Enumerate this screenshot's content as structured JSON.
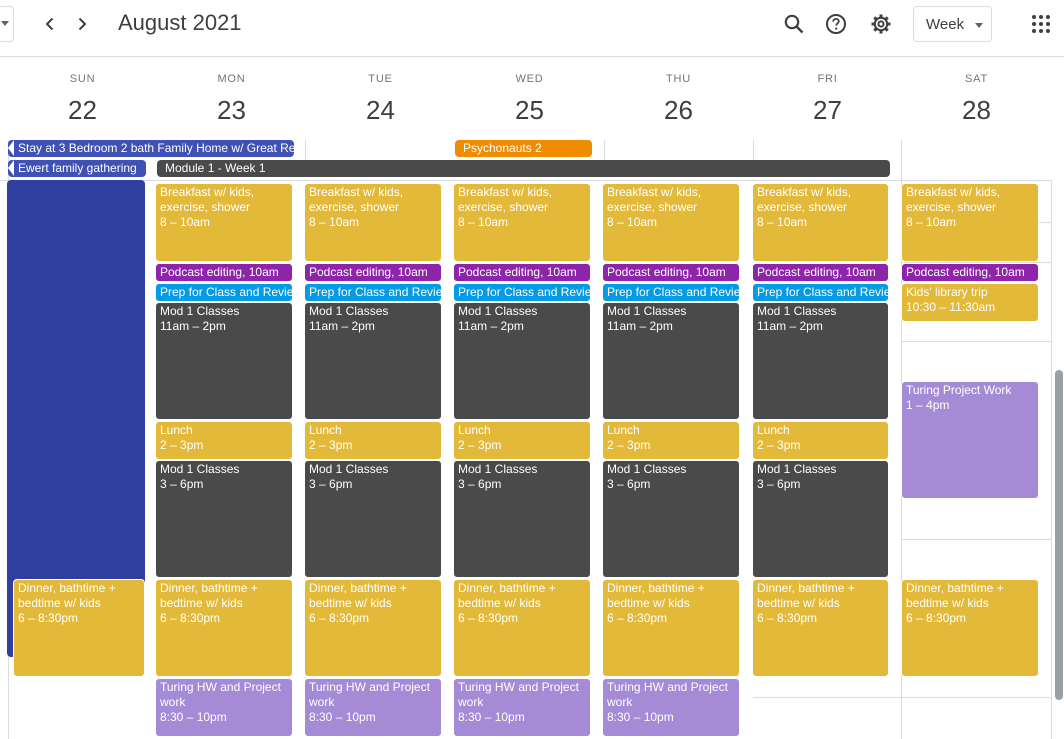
{
  "header": {
    "month_title": "August 2021",
    "view_label": "Week",
    "prev_icon": "chevron-left-icon",
    "next_icon": "chevron-right-icon",
    "search_icon": "search-icon",
    "help_icon": "help-icon",
    "settings_icon": "gear-icon",
    "apps_icon": "apps-grid-icon"
  },
  "days": [
    {
      "dow": "SUN",
      "num": "22"
    },
    {
      "dow": "MON",
      "num": "23"
    },
    {
      "dow": "TUE",
      "num": "24"
    },
    {
      "dow": "WED",
      "num": "25"
    },
    {
      "dow": "THU",
      "num": "26"
    },
    {
      "dow": "FRI",
      "num": "27"
    },
    {
      "dow": "SAT",
      "num": "28"
    }
  ],
  "all_day": {
    "stay": "Stay at 3 Bedroom 2 bath Family Home w/ Great Re",
    "ewert": "Ewert family gathering",
    "psychonauts": "Psychonauts 2",
    "module": "Module 1 - Week 1"
  },
  "events": {
    "breakfast_title": "Breakfast w/ kids, exercise, shower",
    "breakfast_time": "8 – 10am",
    "podcast_title": "Podcast editing",
    "podcast_time": "10am",
    "prep_title": "Prep for Class and Revie",
    "mod_am_title": "Mod 1 Classes",
    "mod_am_time": "11am – 2pm",
    "lunch_title": "Lunch",
    "lunch_time": "2 – 3pm",
    "mod_pm_title": "Mod 1 Classes",
    "mod_pm_time": "3 – 6pm",
    "dinner_title": "Dinner, bathtime + bedtime w/ kids",
    "dinner_time": "6 – 8:30pm",
    "turing_hw_title": "Turing HW and Project work",
    "turing_hw_time": "8:30 – 10pm",
    "library_title": "Kids' library trip",
    "library_time": "10:30 – 11:30am",
    "turing_proj_title": "Turing Project Work",
    "turing_proj_time": "1 – 4pm"
  },
  "colors": {
    "yellow": "#e3b93a",
    "dark": "#4a4a4a",
    "purple": "#8e24aa",
    "blue": "#039be5",
    "lavender": "#a58ad6",
    "navy": "#3f51b5",
    "orange": "#ef8c00"
  }
}
